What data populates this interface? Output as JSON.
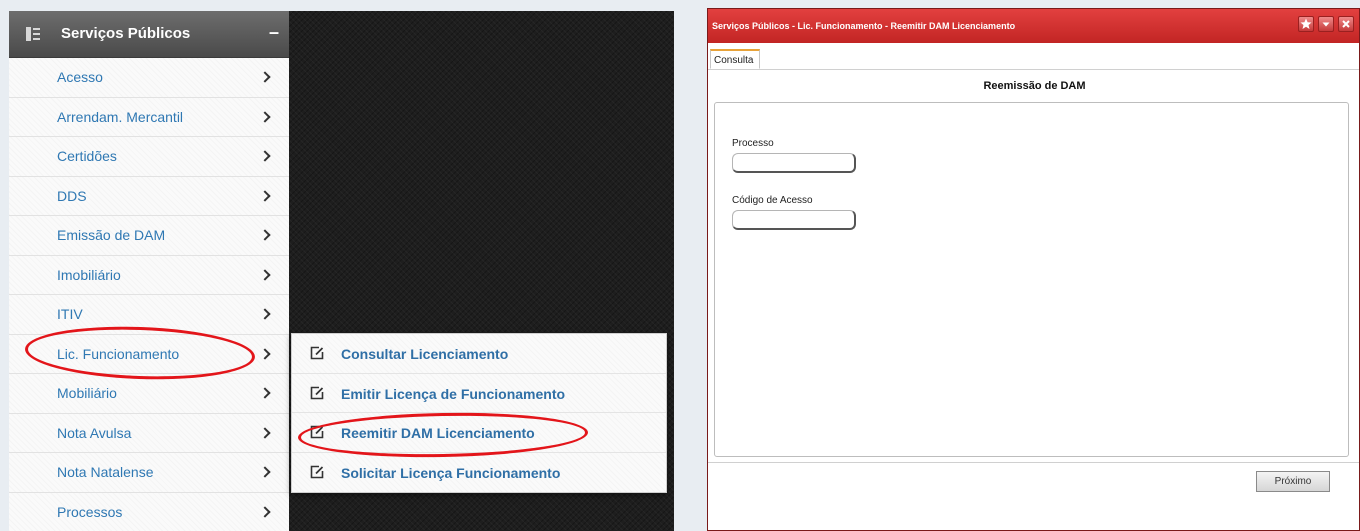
{
  "menu": {
    "title": "Serviços Públicos",
    "collapse_symbol": "–",
    "items": [
      {
        "label": "Acesso"
      },
      {
        "label": "Arrendam. Mercantil"
      },
      {
        "label": "Certidões"
      },
      {
        "label": "DDS"
      },
      {
        "label": "Emissão de DAM"
      },
      {
        "label": "Imobiliário"
      },
      {
        "label": "ITIV"
      },
      {
        "label": "Lic. Funcionamento"
      },
      {
        "label": "Mobiliário"
      },
      {
        "label": "Nota Avulsa"
      },
      {
        "label": "Nota Natalense"
      },
      {
        "label": "Processos"
      }
    ]
  },
  "submenu": {
    "items": [
      {
        "label": "Consultar Licenciamento",
        "icon": "edit-icon"
      },
      {
        "label": "Emitir Licença de Funcionamento",
        "icon": "edit-icon"
      },
      {
        "label": "Reemitir DAM Licenciamento",
        "icon": "edit-icon"
      },
      {
        "label": "Solicitar Licença Funcionamento",
        "icon": "edit-icon"
      }
    ]
  },
  "window": {
    "title": "Serviços Públicos - Lic. Funcionamento - Reemitir DAM Licenciamento",
    "title_icons": [
      "star-icon",
      "dropdown-icon",
      "close-icon"
    ],
    "tab": "Consulta",
    "form_title": "Reemissão de DAM",
    "fields": {
      "processo": {
        "label": "Processo",
        "value": ""
      },
      "codigo": {
        "label": "Código de Acesso",
        "value": ""
      }
    },
    "next_button": "Próximo"
  },
  "colors": {
    "highlight": "#e3151a",
    "menu_link": "#2f78b3",
    "titlebar": "#c22524"
  }
}
